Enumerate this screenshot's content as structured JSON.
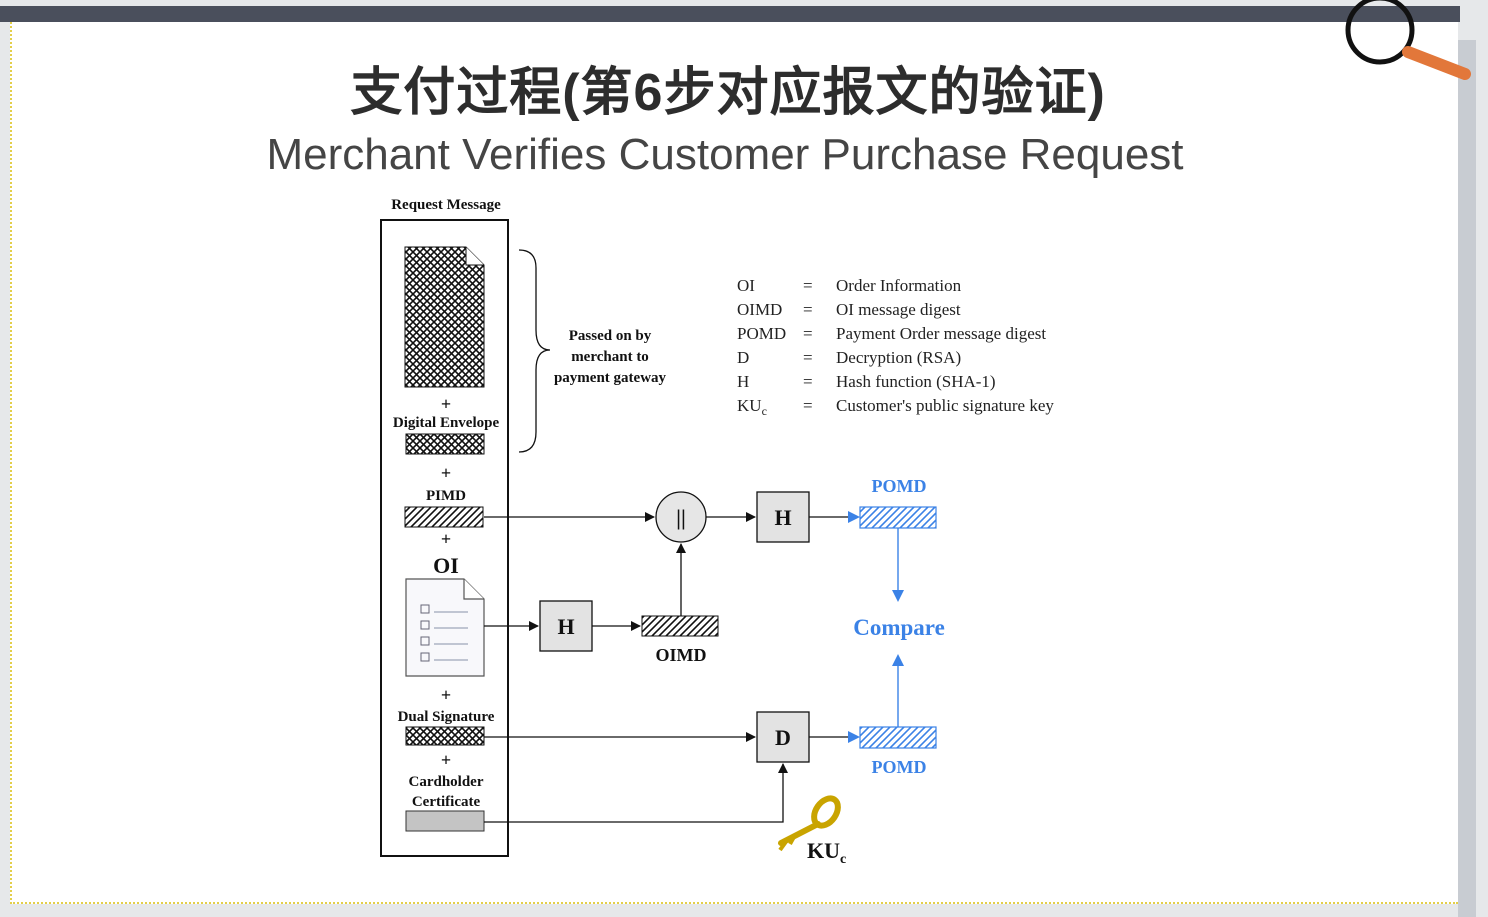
{
  "slide": {
    "title_zh": "支付过程(第6步对应报文的验证)",
    "title_en": "Merchant Verifies Customer Purchase Request"
  },
  "diagram": {
    "request_message_label": "Request Message",
    "plus": "+",
    "digital_envelope_label": "Digital Envelope",
    "pimd_label": "PIMD",
    "oi_label": "OI",
    "dual_signature_label": "Dual Signature",
    "cardholder_line1": "Cardholder",
    "cardholder_line2": "Certificate",
    "passed_line1": "Passed on by",
    "passed_line2": "merchant to",
    "passed_line3": "payment gateway",
    "concat_symbol": "||",
    "hash_label": "H",
    "decrypt_label": "D",
    "oimd_label": "OIMD",
    "pomd_label": "POMD",
    "compare_label": "Compare",
    "key_label": "KU",
    "key_sub": "c"
  },
  "legend": [
    {
      "abbr": "OI",
      "eq": "=",
      "def": "Order Information"
    },
    {
      "abbr": "OIMD",
      "eq": "=",
      "def": "OI message digest"
    },
    {
      "abbr": "POMD",
      "eq": "=",
      "def": "Payment Order message digest"
    },
    {
      "abbr": "D",
      "eq": "=",
      "def": "Decryption (RSA)"
    },
    {
      "abbr": "H",
      "eq": "=",
      "def": "Hash function (SHA-1)"
    },
    {
      "abbr": "KU",
      "abbr_sub": "c",
      "eq": "=",
      "def": "Customer's public signature key"
    }
  ],
  "colors": {
    "accent_blue": "#3b82e6",
    "top_bar": "#4a4f5c",
    "magnifier_handle": "#e2773a"
  },
  "icons": [
    "magnifier-icon",
    "document-icon",
    "key-icon"
  ]
}
